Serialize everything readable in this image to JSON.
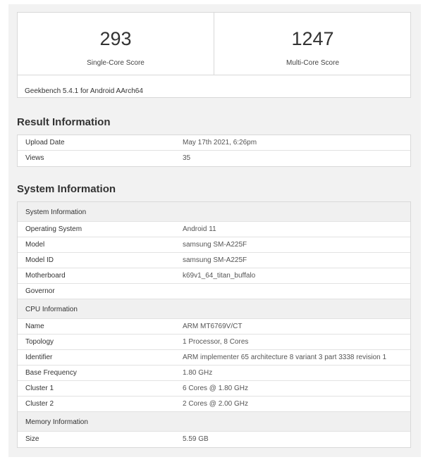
{
  "scores": {
    "single": {
      "value": "293",
      "label": "Single-Core Score"
    },
    "multi": {
      "value": "1247",
      "label": "Multi-Core Score"
    },
    "version": "Geekbench 5.4.1 for Android AArch64"
  },
  "result": {
    "title": "Result Information",
    "rows": [
      {
        "key": "Upload Date",
        "value": "May 17th 2021, 6:26pm"
      },
      {
        "key": "Views",
        "value": "35"
      }
    ]
  },
  "system": {
    "title": "System Information",
    "sections": [
      {
        "heading": "System Information",
        "rows": [
          {
            "key": "Operating System",
            "value": "Android 11"
          },
          {
            "key": "Model",
            "value": "samsung SM-A225F"
          },
          {
            "key": "Model ID",
            "value": "samsung SM-A225F"
          },
          {
            "key": "Motherboard",
            "value": "k69v1_64_titan_buffalo"
          },
          {
            "key": "Governor",
            "value": ""
          }
        ]
      },
      {
        "heading": "CPU Information",
        "rows": [
          {
            "key": "Name",
            "value": "ARM MT6769V/CT"
          },
          {
            "key": "Topology",
            "value": "1 Processor, 8 Cores"
          },
          {
            "key": "Identifier",
            "value": "ARM implementer 65 architecture 8 variant 3 part 3338 revision 1"
          },
          {
            "key": "Base Frequency",
            "value": "1.80 GHz"
          },
          {
            "key": "Cluster 1",
            "value": "6 Cores @ 1.80 GHz"
          },
          {
            "key": "Cluster 2",
            "value": "2 Cores @ 2.00 GHz"
          }
        ]
      },
      {
        "heading": "Memory Information",
        "rows": [
          {
            "key": "Size",
            "value": "5.59 GB"
          }
        ]
      }
    ]
  }
}
